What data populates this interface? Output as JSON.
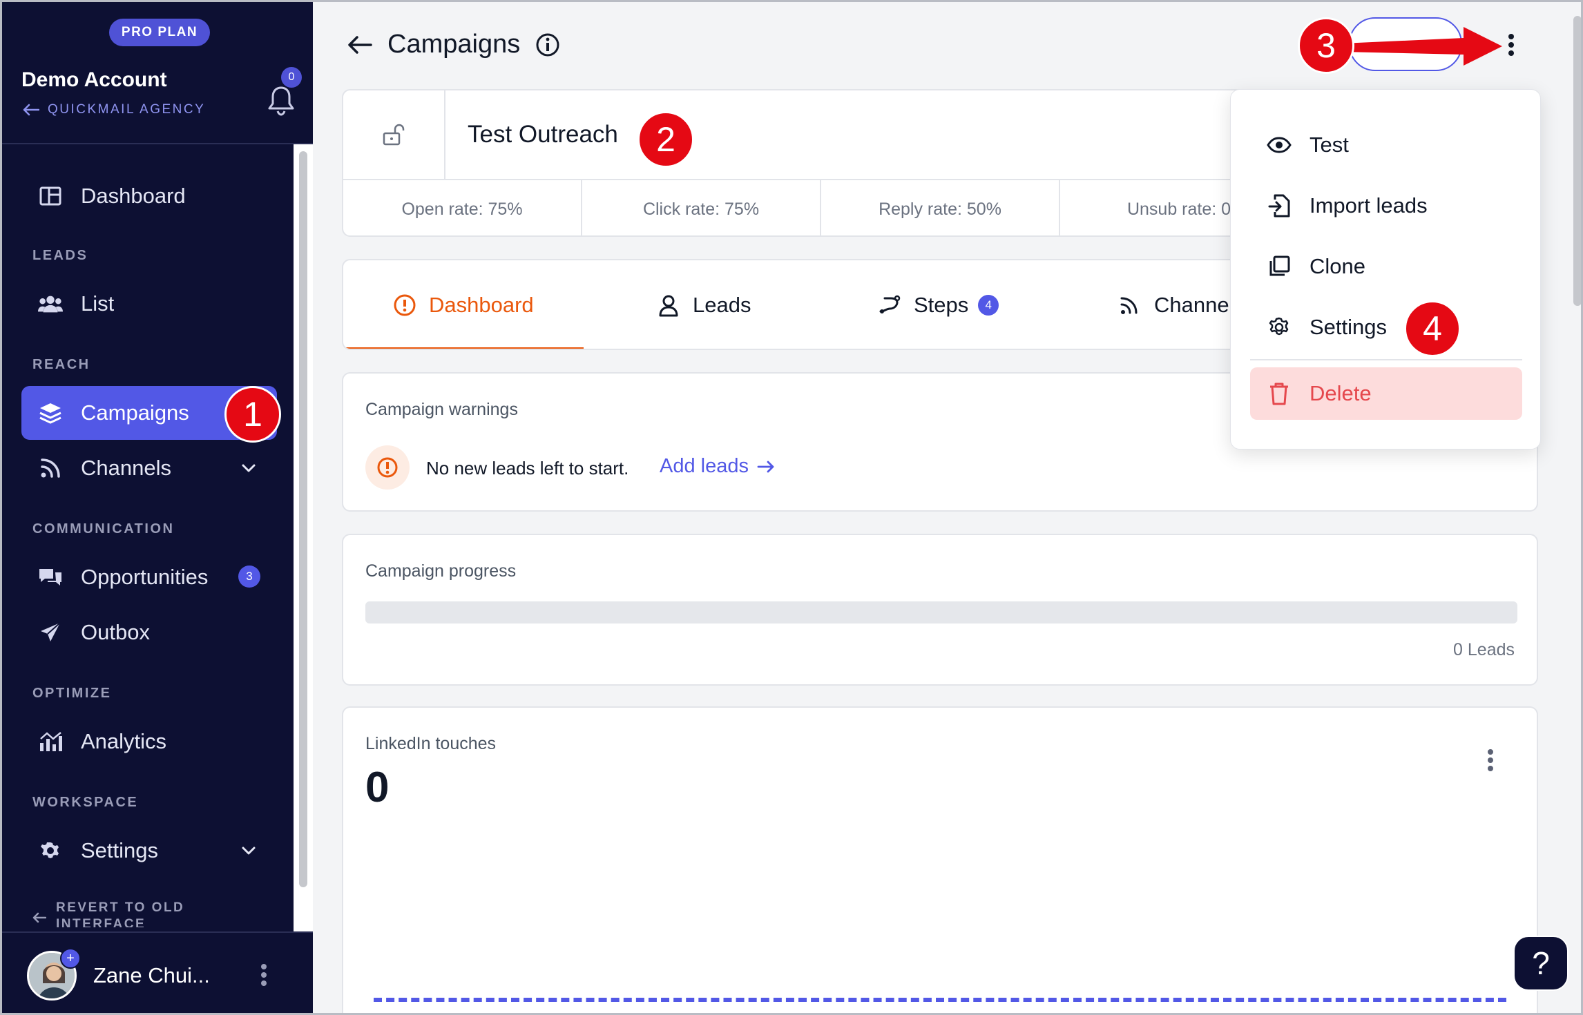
{
  "sidebar": {
    "plan_badge": "PRO PLAN",
    "account_name": "Demo Account",
    "account_sub": "QUICKMAIL AGENCY",
    "notifications_count": "0",
    "items": {
      "dashboard": "Dashboard",
      "list": "List",
      "campaigns": "Campaigns",
      "channels": "Channels",
      "opportunities": "Opportunities",
      "opportunities_count": "3",
      "outbox": "Outbox",
      "analytics": "Analytics",
      "settings": "Settings"
    },
    "sections": {
      "leads": "LEADS",
      "reach": "REACH",
      "communication": "COMMUNICATION",
      "optimize": "OPTIMIZE",
      "workspace": "WORKSPACE"
    },
    "revert": "REVERT TO OLD INTERFACE",
    "user_name": "Zane Chui..."
  },
  "header": {
    "title": "Campaigns"
  },
  "campaign": {
    "name": "Test Outreach",
    "stats": [
      "Open rate: 75%",
      "Click rate: 75%",
      "Reply rate: 50%",
      "Unsub rate: 0"
    ]
  },
  "tabs": {
    "dashboard": "Dashboard",
    "leads": "Leads",
    "steps": "Steps",
    "steps_count": "4",
    "channels": "Channels"
  },
  "warnings": {
    "label": "Campaign warnings",
    "message": "No new leads left to start.",
    "action": "Add leads"
  },
  "progress": {
    "label": "Campaign progress",
    "fraction": 0,
    "count": "0 Leads"
  },
  "linkedin": {
    "label": "LinkedIn touches",
    "value": "0"
  },
  "menu": {
    "test": "Test",
    "import_leads": "Import leads",
    "clone": "Clone",
    "settings": "Settings",
    "delete": "Delete"
  },
  "annotations": {
    "m1": "1",
    "m2": "2",
    "m3": "3",
    "m4": "4"
  },
  "help": "?",
  "colors": {
    "sidebar_bg": "#0d1033",
    "accent": "#5258e6",
    "active_tab": "#ea580c",
    "danger": "#e5484d",
    "annotation": "#e50914"
  }
}
